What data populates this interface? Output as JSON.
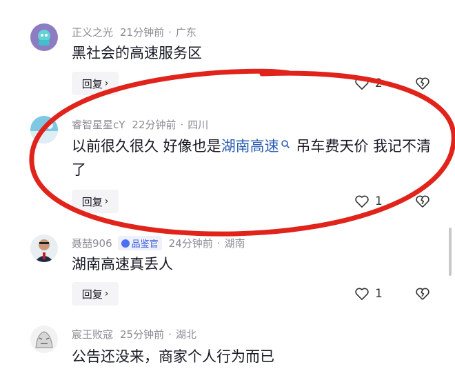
{
  "comments": [
    {
      "username": "正义之光",
      "time": "21分钟前",
      "location": "广东",
      "text": "黑社会的高速服务区",
      "reply_label": "回复",
      "likes": "2"
    },
    {
      "username": "睿智星星cY",
      "time": "22分钟前",
      "location": "四川",
      "text_before": "以前很久很久 好像也是",
      "link_text": "湖南高速",
      "text_after": " 吊车费天价 我记不清了",
      "reply_label": "回复",
      "likes": "1"
    },
    {
      "username": "聂喆906",
      "badge": "品鉴官",
      "time": "24分钟前",
      "location": "湖南",
      "text": "湖南高速真丢人",
      "reply_label": "回复",
      "likes": "1"
    },
    {
      "username": "宸王败寇",
      "time": "25分钟前",
      "location": "湖北",
      "text": "公告还没来，商家个人行为而已"
    }
  ],
  "colors": {
    "highlight_ellipse": "#e0241b",
    "link": "#2a5db0",
    "meta_text": "#8a8b91",
    "reply_bg": "#f4f4f6"
  },
  "icons": [
    "heart-icon",
    "broken-heart-icon",
    "search-icon",
    "chevron-right-icon",
    "verified-badge-icon"
  ]
}
